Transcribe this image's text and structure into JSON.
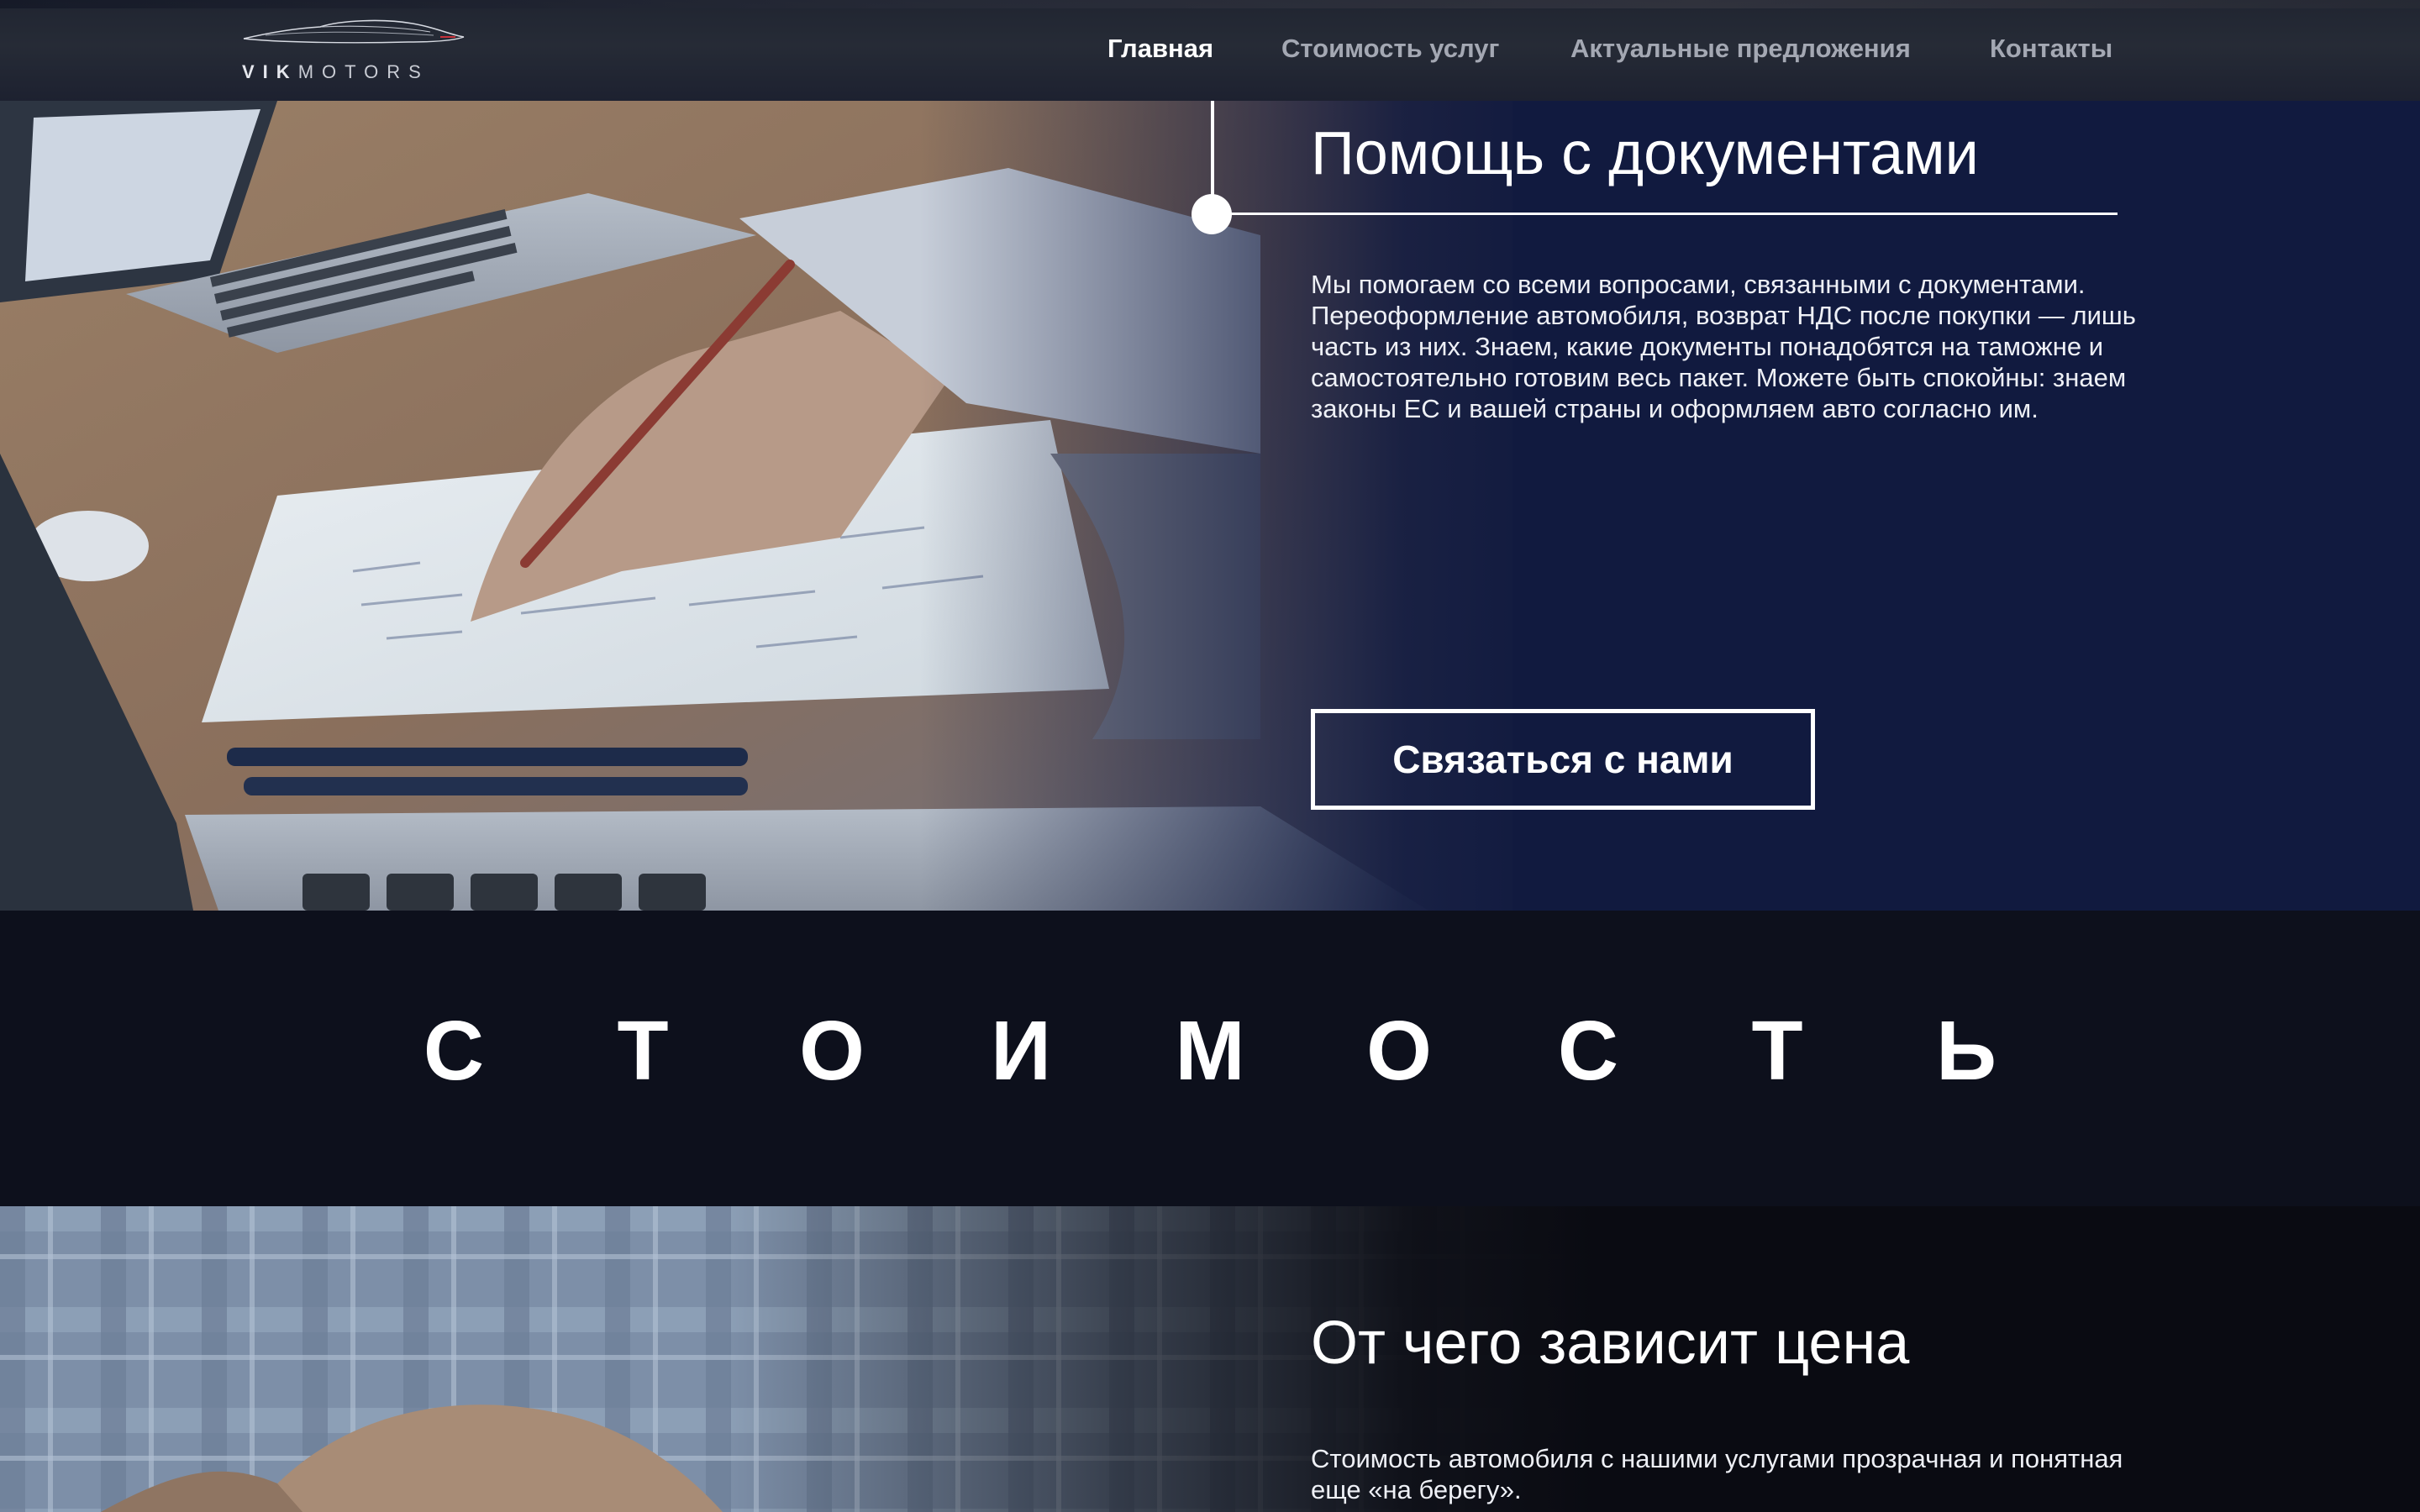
{
  "brand": {
    "logo_bold": "VIK",
    "logo_light": "MOTORS",
    "accent_color": "#111a3f"
  },
  "nav": {
    "items": [
      {
        "label": "Главная",
        "active": true
      },
      {
        "label": "Стоимость услуг",
        "active": false
      },
      {
        "label": "Актуальные предложения",
        "active": false
      },
      {
        "label": "Контакты",
        "active": false
      }
    ]
  },
  "hero": {
    "title": "Помощь с документами",
    "text": "Мы помогаем со всеми вопросами, связанными с документами. Переоформление автомобиля, возврат НДС после покупки — лишь часть из них. Знаем, какие документы понадобятся на таможне и самостоятельно готовим весь пакет. Можете быть спокойны: знаем законы ЕС и вашей страны и оформляем авто согласно им.",
    "button_label": "Связаться с нами"
  },
  "section": {
    "title": "СТОИМОСТЬ"
  },
  "price": {
    "title": "От чего зависит цена",
    "text": "Стоимость автомобиля с нашими услугами прозрачная и понятная еще «на берегу»."
  }
}
